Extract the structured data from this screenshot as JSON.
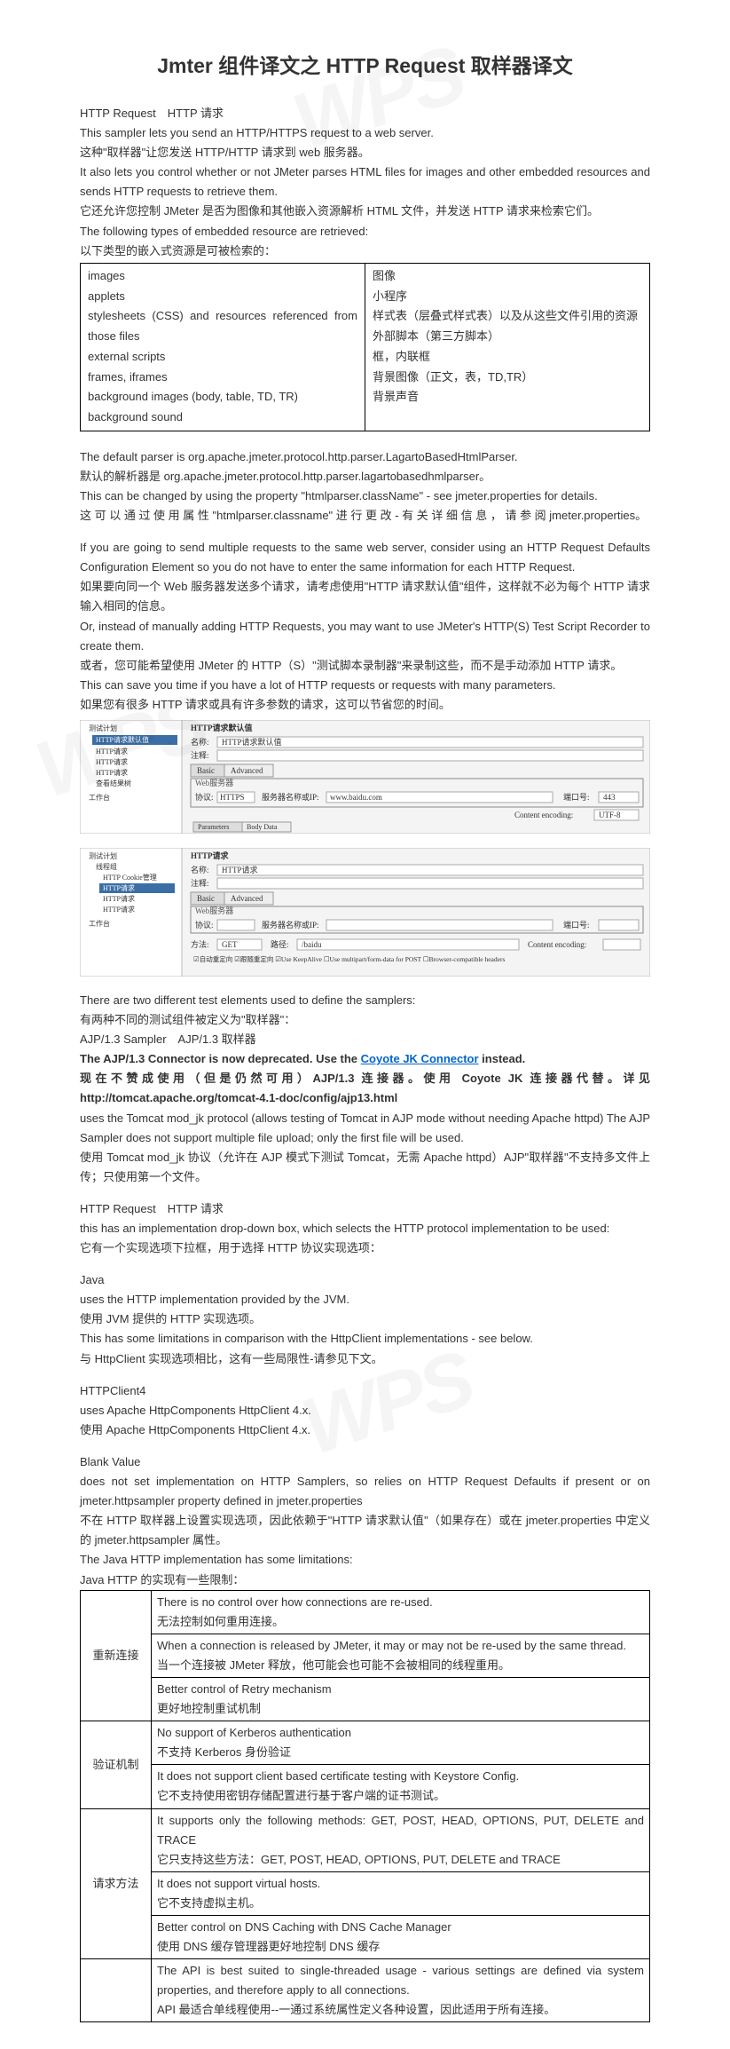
{
  "title": "Jmter 组件译文之 HTTP Request 取样器译文",
  "watermarks": [
    "WPS",
    "WPS",
    "WPS"
  ],
  "intro": [
    "HTTP Request　HTTP 请求",
    "This sampler lets you send an HTTP/HTTPS request to a web server.",
    "这种\"取样器\"让您发送 HTTP/HTTP 请求到 web 服务器。",
    "It also lets you control whether or not JMeter parses HTML files for images and other embedded resources and sends HTTP requests to retrieve them.",
    "它还允许您控制 JMeter 是否为图像和其他嵌入资源解析 HTML 文件，并发送 HTTP 请求来检索它们。",
    "The following types of embedded resource are retrieved:",
    "以下类型的嵌入式资源是可被检索的："
  ],
  "resourceTable": {
    "left": [
      "images",
      "applets",
      "stylesheets (CSS) and resources referenced from those files",
      "external scripts",
      "frames, iframes",
      "background images (body, table, TD, TR)",
      "background sound"
    ],
    "right": [
      "图像",
      "小程序",
      "样式表（层叠式样式表）以及从这些文件引用的资源",
      "外部脚本（第三方脚本）",
      "框，内联框",
      "背景图像（正文，表，TD,TR）",
      "背景声音"
    ]
  },
  "parserBlock": [
    "The default parser is org.apache.jmeter.protocol.http.parser.LagartoBasedHtmlParser.",
    "默认的解析器是 org.apache.jmeter.protocol.http.parser.lagartobasedhmlparser。",
    "This can be changed by using the property \"htmlparser.className\" - see jmeter.properties for details.",
    "这 可 以 通 过 使 用 属 性 \"htmlparser.classname\" 进 行 更 改 - 有 关 详 细 信 息 ， 请 参 阅 jmeter.properties。"
  ],
  "multiReq": [
    "If you are going to send multiple requests to the same web server, consider using an HTTP Request Defaults Configuration Element so you do not have to enter the same information for each HTTP Request.",
    "如果要向同一个 Web 服务器发送多个请求，请考虑使用\"HTTP 请求默认值\"组件，这样就不必为每个 HTTP 请求输入相同的信息。",
    "Or, instead of manually adding HTTP Requests, you may want to use JMeter's HTTP(S) Test Script Recorder to create them.",
    "或者，您可能希望使用 JMeter 的 HTTP（S）\"测试脚本录制器\"来录制这些，而不是手动添加 HTTP 请求。",
    "This can save you time if you have a lot of HTTP requests or requests with many parameters.",
    "如果您有很多 HTTP 请求或具有许多参数的请求，这可以节省您的时间。"
  ],
  "shot1": {
    "tree": [
      "测试计划",
      "HTTP请求默认值",
      "HTTP请求",
      "HTTP请求",
      "HTTP请求",
      "查看结果树",
      "工作台"
    ],
    "panelTitle": "HTTP请求默认值",
    "nameLabel": "名称:",
    "nameVal": "HTTP请求默认值",
    "commentLabel": "注释:",
    "tabs": [
      "Basic",
      "Advanced"
    ],
    "webServer": "Web服务器",
    "protoLabel": "协议:",
    "protoVal": "HTTPS",
    "hostLabel": "服务器名称或IP:",
    "hostVal": "www.baidu.com",
    "portLabel": "端口号:",
    "portVal": "443",
    "encLabel": "Content encoding:",
    "encVal": "UTF-8",
    "bodyTabs": [
      "Parameters",
      "Body Data"
    ]
  },
  "shot2": {
    "tree": [
      "测试计划",
      "线程组",
      "HTTP Cookie管理",
      "HTTP请求",
      "HTTP请求",
      "HTTP请求"
    ],
    "wb": "工作台",
    "panelTitle": "HTTP请求",
    "nameLabel": "名称:",
    "nameVal": "HTTP请求",
    "commentLabel": "注释:",
    "tabs": [
      "Basic",
      "Advanced"
    ],
    "webServer": "Web服务器",
    "protoLabel": "协议:",
    "hostLabel": "服务器名称或IP:",
    "portLabel": "端口号:",
    "method": "方法:",
    "methodVal": "GET",
    "path": "路径:",
    "pathVal": "/baidu",
    "encLabel": "Content encoding:",
    "checks": "☑自动重定向 ☑跟随重定向 ☑Use KeepAlive ☐Use multipart/form-data for POST ☐Browser-compatible headers"
  },
  "samplersBlock": [
    "There are two different test elements used to define the samplers:",
    "有两种不同的测试组件被定义为\"取样器\"：",
    "AJP/1.3 Sampler　AJP/1.3 取样器"
  ],
  "ajpLine": {
    "pre": "The AJP/1.3 Connector is now deprecated. Use the ",
    "link": "Coyote JK Connector",
    "post": " instead."
  },
  "ajpBlock": [
    "现在不赞成使用（但是仍然可用）AJP/1.3 连接器。使用 Coyote JK 连接器代替。详见 http://tomcat.apache.org/tomcat-4.1-doc/config/ajp13.html",
    "uses the Tomcat mod_jk protocol (allows testing of Tomcat in AJP mode without needing Apache httpd) The AJP Sampler does not support multiple file upload; only the first file will be used.",
    "使用 Tomcat mod_jk 协议（允许在 AJP 模式下测试 Tomcat，无需 Apache httpd）AJP\"取样器\"不支持多文件上传；只使用第一个文件。"
  ],
  "httpReqBlock": [
    "HTTP Request　HTTP 请求",
    "this has an implementation drop-down box, which selects the HTTP protocol implementation to be used:",
    "它有一个实现选项下拉框，用于选择 HTTP 协议实现选项："
  ],
  "javaBlock": [
    "Java",
    "uses the HTTP implementation provided by the JVM.",
    "使用 JVM 提供的 HTTP 实现选项。",
    "This has some limitations in comparison with the HttpClient implementations - see below.",
    "与 HttpClient 实现选项相比，这有一些局限性-请参见下文。"
  ],
  "hc4Block": [
    "HTTPClient4",
    "uses Apache HttpComponents HttpClient 4.x.",
    "使用 Apache HttpComponents HttpClient 4.x."
  ],
  "blankBlock": [
    "Blank Value",
    "does not set implementation on HTTP Samplers, so relies on HTTP Request Defaults if present or on jmeter.httpsampler property defined in jmeter.properties",
    "不在 HTTP 取样器上设置实现选项，因此依赖于\"HTTP 请求默认值\"（如果存在）或在 jmeter.properties 中定义的 jmeter.httpsampler 属性。",
    "The Java HTTP implementation has some limitations:",
    "Java HTTP 的实现有一些限制："
  ],
  "limitTable": [
    {
      "head": "重新连接",
      "rows": [
        [
          "There is no control over how connections are re-used.",
          "无法控制如何重用连接。"
        ],
        [
          "When a connection is released by JMeter, it may or may not be re-used by the same thread.",
          "当一个连接被 JMeter 释放，他可能会也可能不会被相同的线程重用。"
        ],
        [
          "Better control of Retry mechanism",
          "更好地控制重试机制"
        ]
      ]
    },
    {
      "head": "验证机制",
      "rows": [
        [
          "No support of Kerberos authentication",
          "不支持 Kerberos 身份验证"
        ],
        [
          "It does not support client based certificate testing with Keystore Config.",
          "它不支持使用密钥存储配置进行基于客户端的证书测试。"
        ]
      ]
    },
    {
      "head": "请求方法",
      "rows": [
        [
          "It supports only the following methods: GET, POST, HEAD, OPTIONS, PUT, DELETE and TRACE",
          "它只支持这些方法：GET, POST, HEAD, OPTIONS, PUT, DELETE and TRACE"
        ],
        [
          "It does not support virtual hosts.",
          "它不支持虚拟主机。"
        ],
        [
          "Better control on DNS Caching with DNS Cache Manager",
          "使用 DNS 缓存管理器更好地控制 DNS 缓存"
        ]
      ]
    },
    {
      "head": "",
      "rows": [
        [
          "The API is best suited to single-threaded usage - various settings are defined via system properties, and therefore apply to all connections.",
          "API 最适合单线程使用--一通过系统属性定义各种设置，因此适用于所有连接。"
        ]
      ]
    }
  ]
}
